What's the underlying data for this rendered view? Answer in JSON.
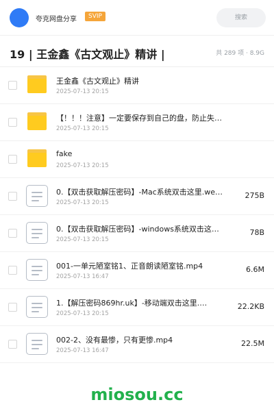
{
  "header": {
    "user_name": "夸克网盘分享",
    "badge": "SVIP",
    "search_placeholder": "搜索",
    "avatar_color": "#2f7bf6",
    "badge_color": "#f5a53a"
  },
  "folder": {
    "title": "19 | 王金鑫《古文观止》精讲 |",
    "meta": "共 289 项 · 8.9G"
  },
  "files": [
    {
      "type": "folder",
      "name": "王金鑫《古文观止》精讲",
      "date": "2025-07-13 20:15",
      "size": ""
    },
    {
      "type": "folder",
      "name": "【！！！注意】一定要保存到自己的盘，防止失效！！！",
      "date": "2025-07-13 20:15",
      "size": ""
    },
    {
      "type": "folder",
      "name": "fake",
      "date": "2025-07-13 20:15",
      "size": ""
    },
    {
      "type": "doc",
      "name": "0.【双击获取解压密码】-Mac系统双击这里.we…",
      "date": "2025-07-13 20:15",
      "size": "275B"
    },
    {
      "type": "doc",
      "name": "0.【双击获取解压密码】-windows系统双击这…",
      "date": "2025-07-13 20:15",
      "size": "78B"
    },
    {
      "type": "doc",
      "name": "001-一单元陋室铭1、正音朗读陋室铭.mp4",
      "date": "2025-07-13 16:47",
      "size": "6.6M"
    },
    {
      "type": "doc",
      "name": "1.【解压密码869hr.uk】-移动端双击这里.…",
      "date": "2025-07-13 20:15",
      "size": "22.2KB"
    },
    {
      "type": "doc",
      "name": "002-2、没有最惨，只有更惨.mp4",
      "date": "2025-07-13 16:47",
      "size": "22.5M"
    }
  ],
  "watermark": "miosou.cc"
}
